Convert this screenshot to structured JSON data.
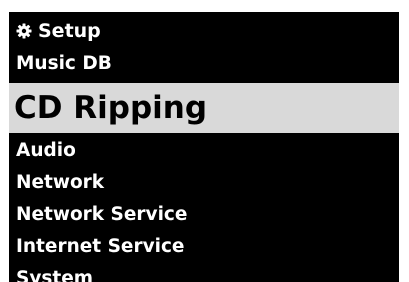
{
  "header": {
    "icon": "gear-icon",
    "title": "Setup"
  },
  "menu": {
    "items": [
      {
        "label": "Music DB",
        "selected": false
      },
      {
        "label": "CD Ripping",
        "selected": true
      },
      {
        "label": "Audio",
        "selected": false
      },
      {
        "label": "Network",
        "selected": false
      },
      {
        "label": "Network Service",
        "selected": false
      },
      {
        "label": "Internet Service",
        "selected": false
      },
      {
        "label": "System",
        "selected": false
      }
    ]
  },
  "colors": {
    "background": "#000000",
    "text": "#ffffff",
    "selected_background": "#d9d9d9",
    "selected_text": "#000000"
  }
}
